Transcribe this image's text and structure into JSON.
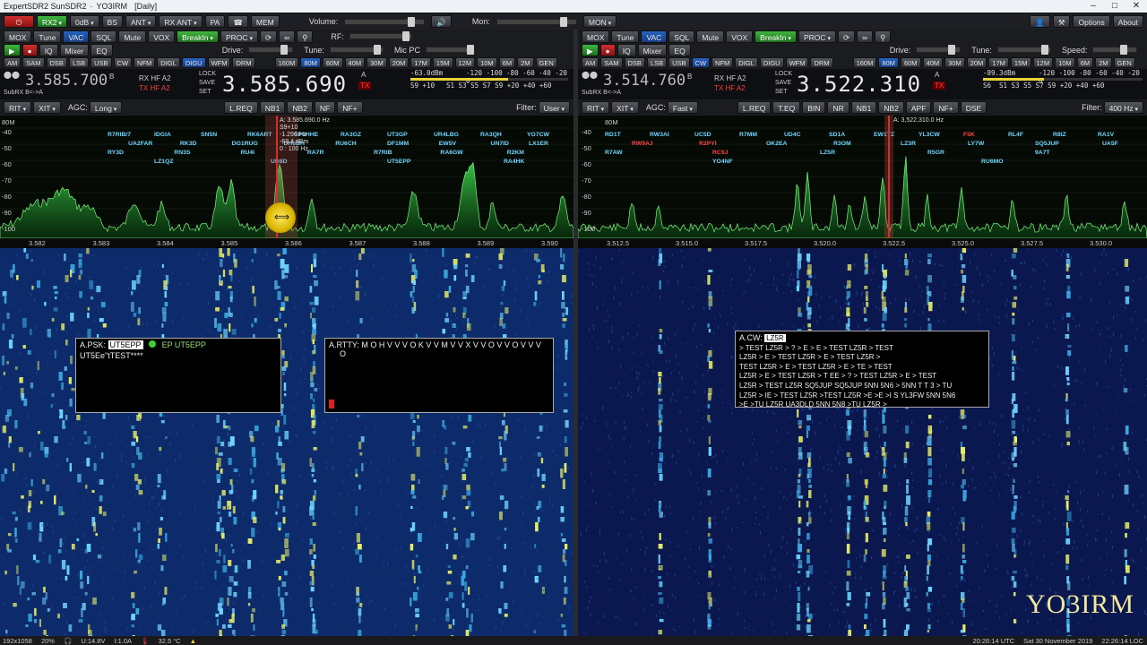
{
  "title": "ExpertSDR2 SunSDR2 · YO3IRM · [Daily]",
  "title_parts": [
    "ExpertSDR2 SunSDR2",
    "YO3IRM",
    "[Daily]"
  ],
  "winbtns": [
    "–",
    "□",
    "✕"
  ],
  "toolbar1": {
    "buttons": [
      "RX2",
      "0dB",
      "BS",
      "ANT",
      "RX ANT",
      "PA",
      "MEM"
    ],
    "volume_label": "Volume:",
    "mon_label": "Mon:",
    "mon_btn": "MON",
    "options": "Options",
    "about": "About"
  },
  "left": {
    "row1": [
      "MOX",
      "Tune",
      "VAC",
      "SQL",
      "Mute",
      "VOX",
      "BreakIn",
      "PROC"
    ],
    "rf": "RF:",
    "drive": "Drive:",
    "tune": "Tune:",
    "micpc": "Mic PC",
    "row2": [
      "IQ",
      "Mixer",
      "EQ"
    ],
    "modes": [
      "AM",
      "SAM",
      "DSB",
      "LSB",
      "USB",
      "CW",
      "NFM",
      "DIGL",
      "DIGU",
      "WFM",
      "DRM"
    ],
    "bands": [
      "160M",
      "80M",
      "60M",
      "40M",
      "30M",
      "20M",
      "17M",
      "15M",
      "12M",
      "10M",
      "6M",
      "2M",
      "GEN"
    ],
    "active_mode": "DIGU",
    "sub_freq": "3.585.700",
    "rxhf": "RX HF  A2",
    "txhf": "TX HF  A2",
    "lock": "LOCK",
    "save": "SAVE",
    "set": "SET",
    "main_freq": "3.585.690",
    "subrx": "SubRX  B<->A",
    "a_label": "A",
    "tx_label": "TX",
    "dbm": "-63.0dBm",
    "s_reading": "S9 +10",
    "s_scale": "S1  S3  S5  S7  S9  +20  +40  +60",
    "dbm_scale": "-120  -100  -80  -60  -40  -20  0",
    "rit": "RIT",
    "xit": "XIT",
    "agc_label": "AGC:",
    "agc_value": "Long",
    "filter_btns": [
      "L.REQ",
      "NB1",
      "NB2",
      "NF",
      "NF+"
    ],
    "filter_label": "Filter:",
    "filter_value": "User",
    "band_label": "80M",
    "db_ticks": [
      "-40",
      "-50",
      "-60",
      "-70",
      "-80",
      "-90",
      "-100"
    ],
    "freq_ticks": [
      "3.582",
      "3.583",
      "3.584",
      "3.585",
      "3.586",
      "3.587",
      "3.588",
      "3.589",
      "3.590"
    ],
    "marker_info": [
      "A: 3.585.690.0 Hz",
      "S9+10",
      "-1.290 Hz",
      "-63.4 dBm",
      "0 : 100 Hz"
    ],
    "spots": [
      {
        "t": "R7RIB/7",
        "c": "#6fd6ff"
      },
      {
        "t": "IDGIA",
        "c": "#6fd6ff"
      },
      {
        "t": "SN5N",
        "c": "#6fd6ff"
      },
      {
        "t": "RK6ART",
        "c": "#6fd6ff"
      },
      {
        "t": "SP6HHE",
        "c": "#6fd6ff"
      },
      {
        "t": "RA3GZ",
        "c": "#6fd6ff"
      },
      {
        "t": "UT3GP",
        "c": "#6fd6ff"
      },
      {
        "t": "UR4LBG",
        "c": "#6fd6ff"
      },
      {
        "t": "RA3QH",
        "c": "#6fd6ff"
      },
      {
        "t": "YO7CW",
        "c": "#6fd6ff"
      },
      {
        "t": "UA2FAR",
        "c": "#6fd6ff"
      },
      {
        "t": "RK3D",
        "c": "#6fd6ff"
      },
      {
        "t": "DG1RUG",
        "c": "#6fd6ff"
      },
      {
        "t": "DH6BH",
        "c": "#6fd6ff"
      },
      {
        "t": "RU6CH",
        "c": "#6fd6ff"
      },
      {
        "t": "DF1MM",
        "c": "#6fd6ff"
      },
      {
        "t": "EW5V",
        "c": "#6fd6ff"
      },
      {
        "t": "UN7ID",
        "c": "#6fd6ff"
      },
      {
        "t": "LX1ER",
        "c": "#6fd6ff"
      },
      {
        "t": "RY3D",
        "c": "#6fd6ff"
      },
      {
        "t": "RN3S",
        "c": "#6fd6ff"
      },
      {
        "t": "RU4I",
        "c": "#6fd6ff"
      },
      {
        "t": "RA7R",
        "c": "#6fd6ff"
      },
      {
        "t": "R7RIB",
        "c": "#6fd6ff"
      },
      {
        "t": "RA6GW",
        "c": "#6fd6ff"
      },
      {
        "t": "R2KM",
        "c": "#6fd6ff"
      },
      {
        "t": "LZ1QZ",
        "c": "#6fd6ff"
      },
      {
        "t": "UD8D",
        "c": "#6fd6ff"
      },
      {
        "t": "UT5EPP",
        "c": "#6fd6ff"
      },
      {
        "t": "RA4HK",
        "c": "#6fd6ff"
      }
    ],
    "psk": {
      "label": "A.PSK:",
      "call": "UT5EPP",
      "call2": "EP UT5EPP",
      "line2": "UT5Ee\"tTEST****"
    },
    "rtty": {
      "label": "A.RTTY:",
      "text": "M O H V V V O K V V M V V X V V O V V O V V V",
      "line2": "O"
    }
  },
  "right": {
    "row1": [
      "MOX",
      "Tune",
      "VAC",
      "SQL",
      "Mute",
      "VOX",
      "BreakIn",
      "PROC"
    ],
    "drive": "Drive:",
    "tune": "Tune:",
    "speed": "Speed:",
    "row2": [
      "IQ",
      "Mixer",
      "EQ"
    ],
    "modes": [
      "AM",
      "SAM",
      "DSB",
      "LSB",
      "USB",
      "CW",
      "NFM",
      "DIGL",
      "DIGU",
      "WFM",
      "DRM"
    ],
    "bands": [
      "160M",
      "80M",
      "60M",
      "40M",
      "30M",
      "20M",
      "17M",
      "15M",
      "12M",
      "10M",
      "6M",
      "2M",
      "GEN"
    ],
    "active_mode": "CW",
    "sub_freq": "3.514.760",
    "rxhf": "RX HF  A2",
    "txhf": "TX HF  A2",
    "lock": "LOCK",
    "save": "SAVE",
    "set": "SET",
    "main_freq": "3.522.310",
    "subrx": "SubRX  B<->A",
    "a_label": "A",
    "tx_label": "TX",
    "dbm": "-89.3dBm",
    "s_reading": "S6",
    "s_scale": "S1  S3  S5  S7  S9  +20  +40  +60",
    "dbm_scale": "-120  -100  -80  -60  -40  -20  0",
    "rit": "RIT",
    "xit": "XIT",
    "agc_label": "AGC:",
    "agc_value": "Fast",
    "filter_btns": [
      "L.REQ",
      "T.EQ",
      "BIN",
      "NR",
      "NB1",
      "NB2",
      "APF",
      "NF+",
      "DSE"
    ],
    "filter_label": "Filter:",
    "filter_value": "400 Hz",
    "band_label": "80M",
    "db_ticks": [
      "-40",
      "-50",
      "-60",
      "-70",
      "-80",
      "-90",
      "-100"
    ],
    "freq_ticks": [
      "3.512.5",
      "3.515.0",
      "3.517.5",
      "3.520.0",
      "3.522.5",
      "3.525.0",
      "3.527.5",
      "3.530.0"
    ],
    "marker_info": [
      "A: 3,522,310.0 Hz"
    ],
    "spots": [
      {
        "t": "RD1T",
        "c": "#6fd6ff"
      },
      {
        "t": "RW3AI",
        "c": "#6fd6ff"
      },
      {
        "t": "UC5D",
        "c": "#6fd6ff"
      },
      {
        "t": "R7MM",
        "c": "#6fd6ff"
      },
      {
        "t": "UD4C",
        "c": "#6fd6ff"
      },
      {
        "t": "SD1A",
        "c": "#6fd6ff"
      },
      {
        "t": "EW1TZ",
        "c": "#6fd6ff"
      },
      {
        "t": "YL3CW",
        "c": "#6fd6ff"
      },
      {
        "t": "F5K",
        "c": "#ff4444"
      },
      {
        "t": "RL4F",
        "c": "#6fd6ff"
      },
      {
        "t": "R8IZ",
        "c": "#6fd6ff"
      },
      {
        "t": "RA1V",
        "c": "#6fd6ff"
      },
      {
        "t": "RW9AJ",
        "c": "#ff4444"
      },
      {
        "t": "R2PYI",
        "c": "#ff4444"
      },
      {
        "t": "OK2EA",
        "c": "#6fd6ff"
      },
      {
        "t": "R3OM",
        "c": "#6fd6ff"
      },
      {
        "t": "LZ3R",
        "c": "#6fd6ff"
      },
      {
        "t": "LY7W",
        "c": "#6fd6ff"
      },
      {
        "t": "SQ5JUP",
        "c": "#6fd6ff"
      },
      {
        "t": "UA5F",
        "c": "#6fd6ff"
      },
      {
        "t": "R7AW",
        "c": "#6fd6ff"
      },
      {
        "t": "RC9J",
        "c": "#ff4444"
      },
      {
        "t": "LZ5R",
        "c": "#6fd6ff"
      },
      {
        "t": "R5GR",
        "c": "#6fd6ff"
      },
      {
        "t": "9A7T",
        "c": "#6fd6ff"
      },
      {
        "t": "YO4NF",
        "c": "#6fd6ff"
      },
      {
        "t": "RU6MO",
        "c": "#6fd6ff"
      }
    ],
    "cw": {
      "label": "A.CW:",
      "call": "LZ5R",
      "lines": [
        "> TEST LZ5R > ? > E > E > TEST LZ5R > TEST",
        "LZ5R > E > TEST LZ5R > E > TEST LZ5R >",
        "TEST LZ5R > E > TEST LZ5R > E > TE > TEST",
        "LZ5R > E > TEST LZ5R > T EE > ? > TEST LZ5R > E > TEST",
        "LZ5R > TEST LZ5R SQ5JUP SQ5JUP 5NN 5N6 > 5NN T T 3 > TU",
        "LZ5R > IE > TEST LZ5R >TEST LZ5R >E >E >I S YL3FW 5NN 5N6",
        ">E >TU LZ5R UA3DLD 5NN 5N8 >TU LZ5R >"
      ]
    }
  },
  "status": {
    "samplerate": "192x1058",
    "cpu": "20%",
    "voltage": "U:14.8V",
    "current": "I:1.0A",
    "temp": "32.5 °C",
    "utc": "20:26:14 UTC",
    "date": "Sat 30 November 2019",
    "local": "22:26:14 LOC"
  },
  "watermark": "YO3IRM",
  "colors": {
    "accent_blue": "#2563c4",
    "spectrum_green": "#2ebd3a",
    "tx_red": "#ff3b3b",
    "waterfall_bg": "#0a1440"
  }
}
